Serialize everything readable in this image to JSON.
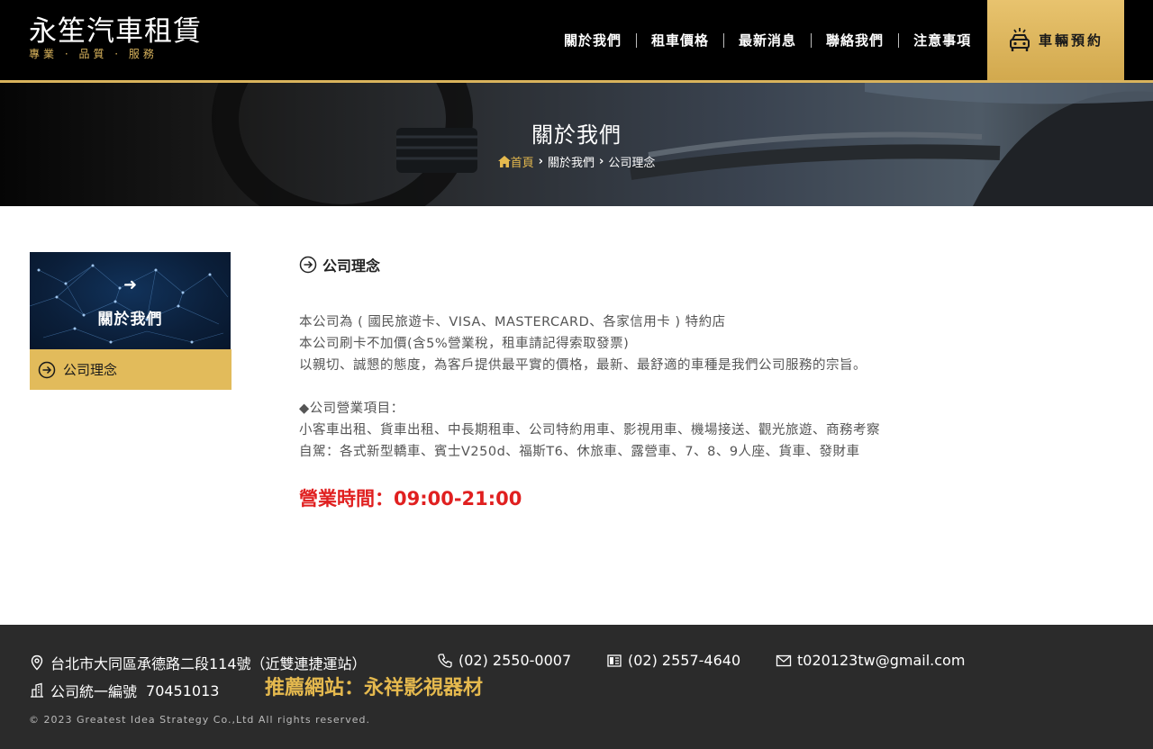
{
  "header": {
    "logo_title": "永笙汽車租賃",
    "logo_slogan": "專業 · 品質 · 服務",
    "nav": [
      "關於我們",
      "租車價格",
      "最新消息",
      "聯絡我們",
      "注意事項"
    ],
    "booking_label": "車輛預約"
  },
  "banner": {
    "title": "關於我們",
    "breadcrumb": {
      "home": "首頁",
      "level1": "關於我們",
      "level2": "公司理念"
    }
  },
  "sidebar": {
    "card_title": "關於我們",
    "items": [
      "公司理念"
    ]
  },
  "content": {
    "heading": "公司理念",
    "lines": [
      "本公司為 ( 國民旅遊卡、VISA、MASTERCARD、各家信用卡 ) 特約店",
      "本公司刷卡不加價(含5%營業稅，租車請記得索取發票)",
      "以親切、誠懇的態度，為客戶提供最平實的價格，最新、最舒適的車種是我們公司服務的宗旨。"
    ],
    "services_title": "◆公司營業項目：",
    "services_lines": [
      "小客車出租、貨車出租、中長期租車、公司特約用車、影視用車、機場接送、觀光旅遊、商務考察",
      "自駕：各式新型轎車、賓士V250d、福斯T6、休旅車、露營車、7、8、9人座、貨車、發財車"
    ],
    "hours": "營業時間：09:00-21:00"
  },
  "footer": {
    "address": "台北市大同區承德路二段114號（近雙連捷運站）",
    "phone": "(02) 2550-0007",
    "fax": "(02) 2557-4640",
    "email": "t020123tw@gmail.com",
    "tax_id_label": "公司統一編號",
    "tax_id": "70451013",
    "recommend": "推薦網站：永祥影視器材",
    "copyright": "© 2023   Greatest Idea Strategy Co.,Ltd All rights reserved."
  },
  "colors": {
    "gold": "#e2bb5b",
    "header_bg": "#000000",
    "footer_bg": "#2b2b2b",
    "hours_red": "#e02020"
  },
  "icons": [
    "car-icon",
    "home-icon",
    "arrow-right-icon",
    "circle-arrow-icon",
    "location-pin-icon",
    "phone-icon",
    "fax-icon",
    "mail-icon",
    "building-icon"
  ]
}
